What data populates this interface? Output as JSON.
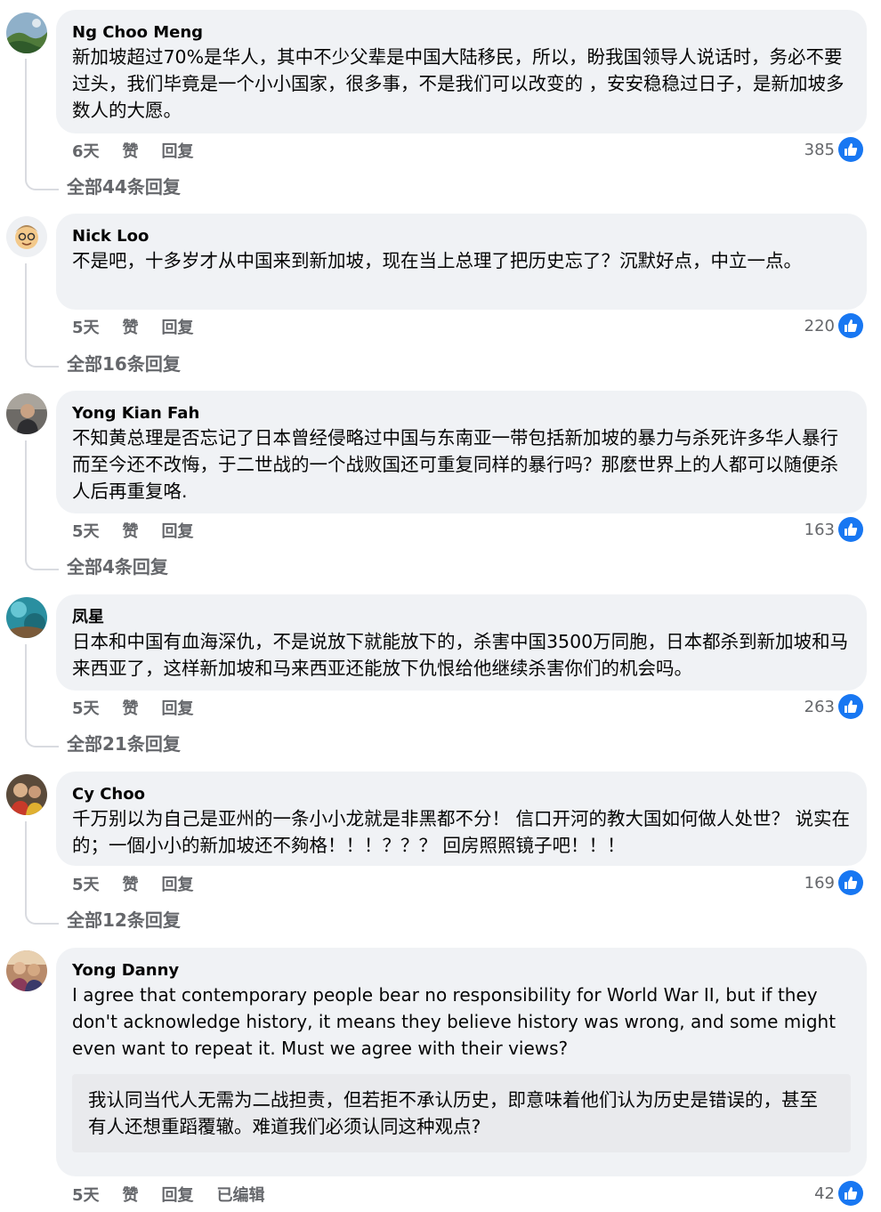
{
  "comments": [
    {
      "author": "Ng Choo Meng",
      "text": "新加坡超过70%是华人，其中不少父辈是中国大陆移民，所以，盼我国领导人说话时，务必不要过头，我们毕竟是一个小小国家，很多事，不是我们可以改变的 ，安安稳稳过日子，是新加坡多数人的大愿。",
      "age": "6天",
      "like_label": "赞",
      "reply_label": "回复",
      "likes": "385",
      "view_replies": "全部44条回复"
    },
    {
      "author": "Nick Loo",
      "text": "不是吧，十多岁才从中国来到新加坡，现在当上总理了把历史忘了？沉默好点，中立一点。",
      "age": "5天",
      "like_label": "赞",
      "reply_label": "回复",
      "likes": "220",
      "view_replies": "全部16条回复"
    },
    {
      "author": "Yong Kian Fah",
      "text": "不知黄总理是否忘记了日本曾经侵略过中国与东南亚一带包括新加坡的暴力与杀死许多华人暴行而至今还不改悔，于二世战的一个战败国还可重复同样的暴行吗？那麽世界上的人都可以随便杀人后再重复咯.",
      "age": "5天",
      "like_label": "赞",
      "reply_label": "回复",
      "likes": "163",
      "view_replies": "全部4条回复"
    },
    {
      "author": "凤星",
      "text": "日本和中国有血海深仇，不是说放下就能放下的，杀害中国3500万同胞，日本都杀到新加坡和马来西亚了，这样新加坡和马来西亚还能放下仇恨给他继续杀害你们的机会吗。",
      "age": "5天",
      "like_label": "赞",
      "reply_label": "回复",
      "likes": "263",
      "view_replies": "全部21条回复"
    },
    {
      "author": "Cy Choo",
      "text": "千万别以为自己是亚州的一条小小龙就是非黑都不分！ 信口开河的教大国如何做人处世？ 说实在的；一個小小的新加坡还不夠格！！！？？？ 回房照照镜子吧！！！",
      "age": "5天",
      "like_label": "赞",
      "reply_label": "回复",
      "likes": "169",
      "view_replies": "全部12条回复"
    },
    {
      "author": "Yong Danny",
      "text": "I agree that contemporary people bear no responsibility for World War II, but if they don't acknowledge history, it means they believe history was wrong, and some might even want to repeat it. Must we agree with their views?",
      "translation": "我认同当代人无需为二战担责，但若拒不承认历史，即意味着他们认为历史是错误的，甚至有人还想重蹈覆辙。难道我们必须认同这种观点?",
      "age": "5天",
      "like_label": "赞",
      "reply_label": "回复",
      "edited_label": "已编辑",
      "likes": "42"
    }
  ],
  "colors": {
    "bubble": "#f0f2f5",
    "meta": "#65676b",
    "like": "#1877f2"
  },
  "icons": [
    "like-thumb-icon"
  ]
}
